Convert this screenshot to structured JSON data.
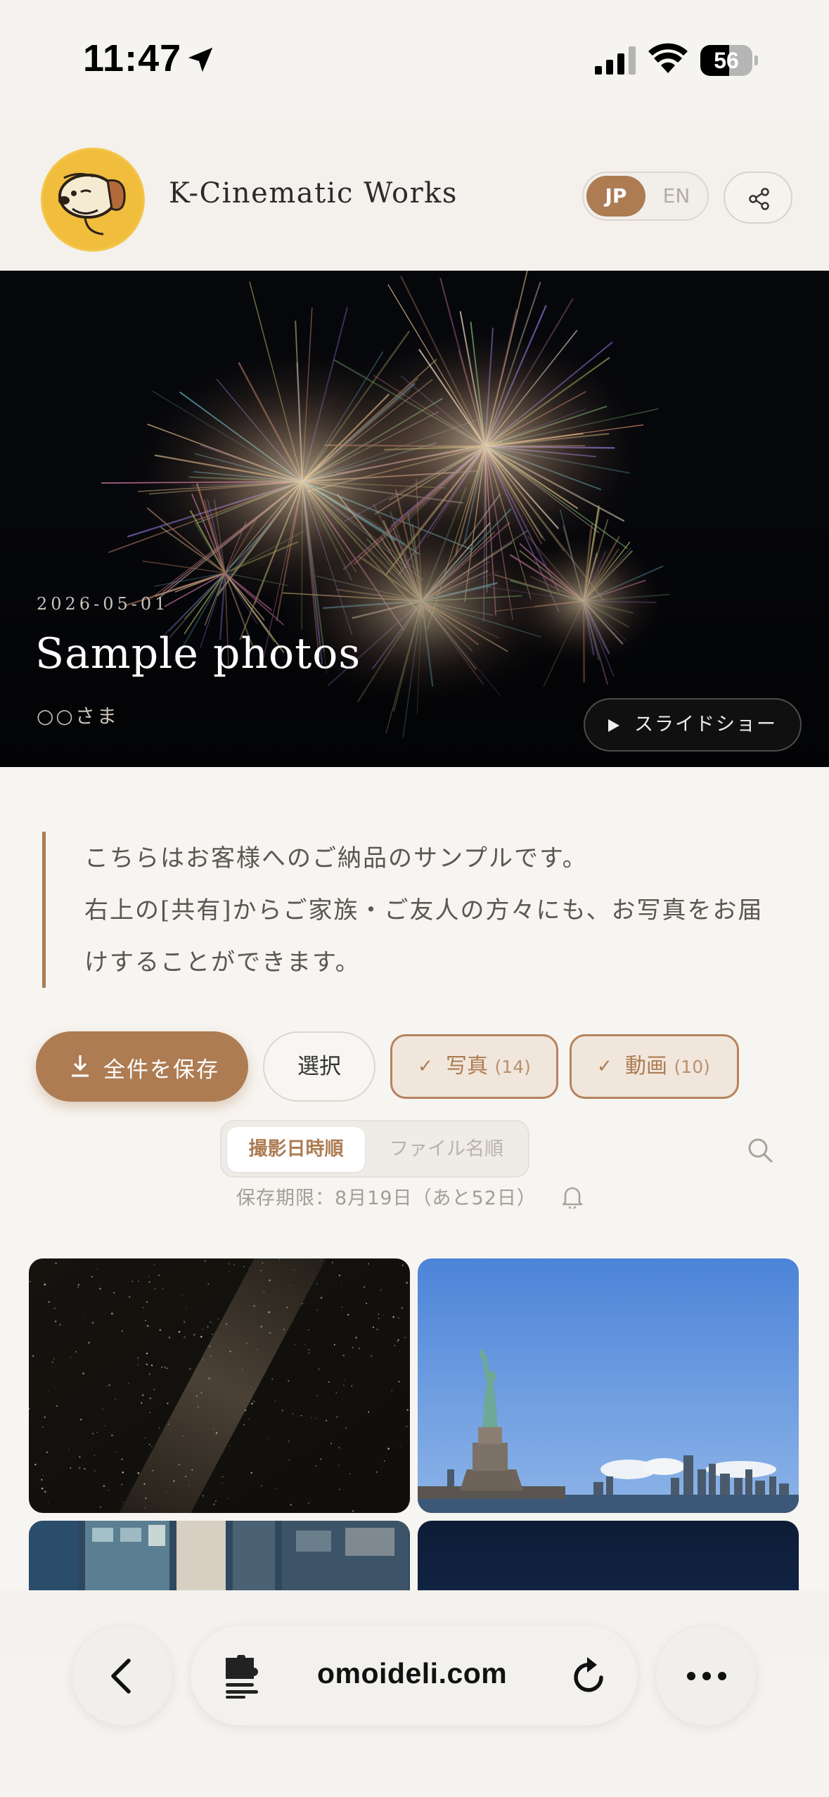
{
  "status_bar": {
    "time": "11:47",
    "battery": "56",
    "battery_level": 0.56
  },
  "header": {
    "brand": "K-Cinematic Works",
    "lang_jp": "JP",
    "lang_en": "EN",
    "active_lang": "JP"
  },
  "hero": {
    "date": "2026-05-01",
    "title": "Sample photos",
    "recipient": "○○さま",
    "slideshow_label": "スライドショー"
  },
  "notice": {
    "line1": "こちらはお客様へのご納品のサンプルです。",
    "line2": "右上の[共有]からご家族・ご友人の方々にも、お写真をお届",
    "line3": "けすることができます。"
  },
  "actions": {
    "save_all": "全件を保存",
    "select": "選択",
    "photos_label": "写真",
    "photos_count": "(14)",
    "videos_label": "動画",
    "videos_count": "(10)"
  },
  "sort": {
    "by_date": "撮影日時順",
    "by_filename": "ファイル名順",
    "active": "by_date"
  },
  "expiry": "保存期限：8月19日（あと52日）",
  "browser": {
    "url": "omoideli.com"
  },
  "colors": {
    "accent": "#ad7c53",
    "background": "#f7f5f1",
    "avatar_bg": "#f1bd3d"
  },
  "icons": {
    "location": "location-arrow-icon",
    "signal": "cellular-signal-icon",
    "wifi": "wifi-icon",
    "share": "share-icon",
    "play": "play-icon",
    "download": "download-icon",
    "check": "check-icon",
    "search": "search-icon",
    "bell": "bell-icon",
    "back": "chevron-left-icon",
    "extension": "puzzle-icon",
    "reload": "reload-icon",
    "more": "more-icon"
  }
}
